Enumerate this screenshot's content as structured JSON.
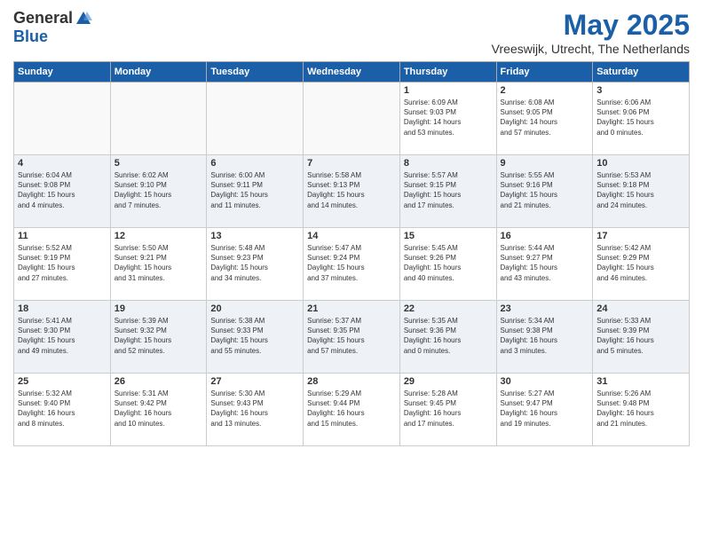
{
  "header": {
    "logo_general": "General",
    "logo_blue": "Blue",
    "title": "May 2025",
    "location": "Vreeswijk, Utrecht, The Netherlands"
  },
  "days_of_week": [
    "Sunday",
    "Monday",
    "Tuesday",
    "Wednesday",
    "Thursday",
    "Friday",
    "Saturday"
  ],
  "weeks": [
    [
      {
        "day": "",
        "info": ""
      },
      {
        "day": "",
        "info": ""
      },
      {
        "day": "",
        "info": ""
      },
      {
        "day": "",
        "info": ""
      },
      {
        "day": "1",
        "info": "Sunrise: 6:09 AM\nSunset: 9:03 PM\nDaylight: 14 hours\nand 53 minutes."
      },
      {
        "day": "2",
        "info": "Sunrise: 6:08 AM\nSunset: 9:05 PM\nDaylight: 14 hours\nand 57 minutes."
      },
      {
        "day": "3",
        "info": "Sunrise: 6:06 AM\nSunset: 9:06 PM\nDaylight: 15 hours\nand 0 minutes."
      }
    ],
    [
      {
        "day": "4",
        "info": "Sunrise: 6:04 AM\nSunset: 9:08 PM\nDaylight: 15 hours\nand 4 minutes."
      },
      {
        "day": "5",
        "info": "Sunrise: 6:02 AM\nSunset: 9:10 PM\nDaylight: 15 hours\nand 7 minutes."
      },
      {
        "day": "6",
        "info": "Sunrise: 6:00 AM\nSunset: 9:11 PM\nDaylight: 15 hours\nand 11 minutes."
      },
      {
        "day": "7",
        "info": "Sunrise: 5:58 AM\nSunset: 9:13 PM\nDaylight: 15 hours\nand 14 minutes."
      },
      {
        "day": "8",
        "info": "Sunrise: 5:57 AM\nSunset: 9:15 PM\nDaylight: 15 hours\nand 17 minutes."
      },
      {
        "day": "9",
        "info": "Sunrise: 5:55 AM\nSunset: 9:16 PM\nDaylight: 15 hours\nand 21 minutes."
      },
      {
        "day": "10",
        "info": "Sunrise: 5:53 AM\nSunset: 9:18 PM\nDaylight: 15 hours\nand 24 minutes."
      }
    ],
    [
      {
        "day": "11",
        "info": "Sunrise: 5:52 AM\nSunset: 9:19 PM\nDaylight: 15 hours\nand 27 minutes."
      },
      {
        "day": "12",
        "info": "Sunrise: 5:50 AM\nSunset: 9:21 PM\nDaylight: 15 hours\nand 31 minutes."
      },
      {
        "day": "13",
        "info": "Sunrise: 5:48 AM\nSunset: 9:23 PM\nDaylight: 15 hours\nand 34 minutes."
      },
      {
        "day": "14",
        "info": "Sunrise: 5:47 AM\nSunset: 9:24 PM\nDaylight: 15 hours\nand 37 minutes."
      },
      {
        "day": "15",
        "info": "Sunrise: 5:45 AM\nSunset: 9:26 PM\nDaylight: 15 hours\nand 40 minutes."
      },
      {
        "day": "16",
        "info": "Sunrise: 5:44 AM\nSunset: 9:27 PM\nDaylight: 15 hours\nand 43 minutes."
      },
      {
        "day": "17",
        "info": "Sunrise: 5:42 AM\nSunset: 9:29 PM\nDaylight: 15 hours\nand 46 minutes."
      }
    ],
    [
      {
        "day": "18",
        "info": "Sunrise: 5:41 AM\nSunset: 9:30 PM\nDaylight: 15 hours\nand 49 minutes."
      },
      {
        "day": "19",
        "info": "Sunrise: 5:39 AM\nSunset: 9:32 PM\nDaylight: 15 hours\nand 52 minutes."
      },
      {
        "day": "20",
        "info": "Sunrise: 5:38 AM\nSunset: 9:33 PM\nDaylight: 15 hours\nand 55 minutes."
      },
      {
        "day": "21",
        "info": "Sunrise: 5:37 AM\nSunset: 9:35 PM\nDaylight: 15 hours\nand 57 minutes."
      },
      {
        "day": "22",
        "info": "Sunrise: 5:35 AM\nSunset: 9:36 PM\nDaylight: 16 hours\nand 0 minutes."
      },
      {
        "day": "23",
        "info": "Sunrise: 5:34 AM\nSunset: 9:38 PM\nDaylight: 16 hours\nand 3 minutes."
      },
      {
        "day": "24",
        "info": "Sunrise: 5:33 AM\nSunset: 9:39 PM\nDaylight: 16 hours\nand 5 minutes."
      }
    ],
    [
      {
        "day": "25",
        "info": "Sunrise: 5:32 AM\nSunset: 9:40 PM\nDaylight: 16 hours\nand 8 minutes."
      },
      {
        "day": "26",
        "info": "Sunrise: 5:31 AM\nSunset: 9:42 PM\nDaylight: 16 hours\nand 10 minutes."
      },
      {
        "day": "27",
        "info": "Sunrise: 5:30 AM\nSunset: 9:43 PM\nDaylight: 16 hours\nand 13 minutes."
      },
      {
        "day": "28",
        "info": "Sunrise: 5:29 AM\nSunset: 9:44 PM\nDaylight: 16 hours\nand 15 minutes."
      },
      {
        "day": "29",
        "info": "Sunrise: 5:28 AM\nSunset: 9:45 PM\nDaylight: 16 hours\nand 17 minutes."
      },
      {
        "day": "30",
        "info": "Sunrise: 5:27 AM\nSunset: 9:47 PM\nDaylight: 16 hours\nand 19 minutes."
      },
      {
        "day": "31",
        "info": "Sunrise: 5:26 AM\nSunset: 9:48 PM\nDaylight: 16 hours\nand 21 minutes."
      }
    ]
  ]
}
